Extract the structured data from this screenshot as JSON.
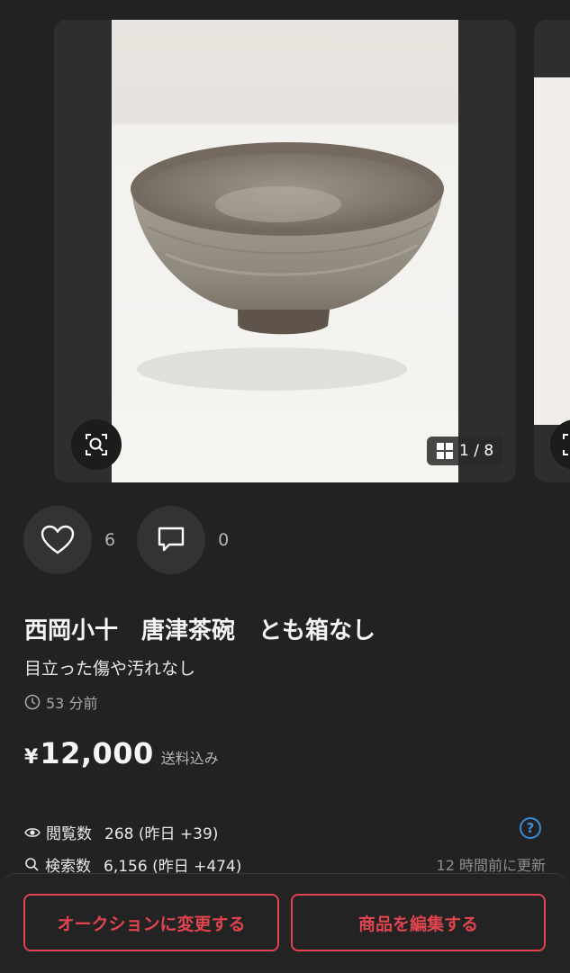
{
  "gallery": {
    "counter": "1 / 8"
  },
  "actions": {
    "like_count": "6",
    "comment_count": "0"
  },
  "item": {
    "title": "西岡小十　唐津茶碗　とも箱なし",
    "subtitle": "目立った傷や汚れなし",
    "posted": "53 分前",
    "currency": "¥",
    "price": "12,000",
    "shipping": "送料込み"
  },
  "stats": {
    "views_label": "閲覧数",
    "views_value": "268 (昨日 +39)",
    "search_label": "検索数",
    "search_value": "6,156 (昨日 +474)",
    "updated": "12 時間前に更新"
  },
  "bottom": {
    "auction_button": "オークションに変更する",
    "edit_button": "商品を編集する"
  },
  "colors": {
    "accent_red": "#e0444f",
    "help_blue": "#3d8bd9",
    "background": "#222222"
  }
}
